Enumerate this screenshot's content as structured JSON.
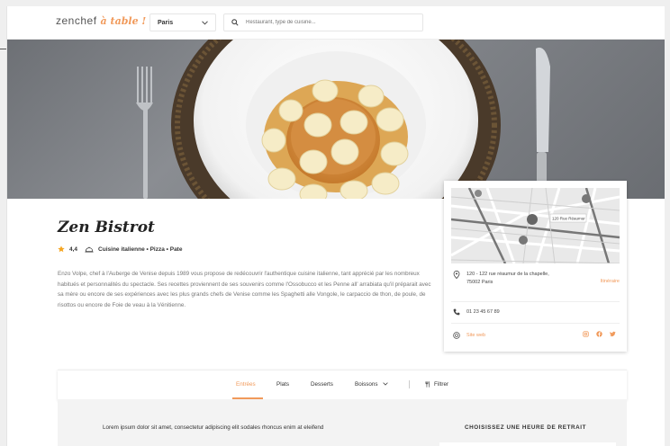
{
  "header": {
    "logo": "zenchef",
    "logo_tagline": "à table !",
    "city": "Paris",
    "search_placeholder": "Restaurant, type de cuisine..."
  },
  "restaurant": {
    "name": "Zen Bistrot",
    "rating": "4,4",
    "cuisines": "Cuisine italienne • Pizza • Pate",
    "description": "Enzo Volpe, chef à l'Auberge de Venise depuis 1989 vous propose de redécouvrir l'authentique cuisine italienne, tant apprécié par les nombreux habitués et personnalités du spectacle. Ses recettes proviennent de ses souvenirs comme l'Ossobucco et les Penne all' arrabiata qu'il préparait avec sa mère ou encore de ses expériences avec les plus grands chefs de Venise comme les Spaghetti alle Vongole, le carpaccio de thon, de poule, de risottos ou encore de Foie de veau à la Vénitienne."
  },
  "info_card": {
    "map_label": "120 Rue Réaumur",
    "address_line1": "120 - 122 rue réaumur de la chapelle,",
    "address_line2": "75002 Paris",
    "itinerary": "Itinéraire",
    "phone": "01 23 45 67 89",
    "website": "Site web"
  },
  "menu": {
    "tabs": [
      {
        "label": "Entrées",
        "active": true
      },
      {
        "label": "Plats",
        "active": false
      },
      {
        "label": "Desserts",
        "active": false
      },
      {
        "label": "Boissons",
        "active": false
      }
    ],
    "filter": "Filtrer"
  },
  "content": {
    "lorem": "Lorem ipsum dolor sit amet, consectetur adipiscing elit sodales rhoncus enim at eleifend",
    "pickup_title": "CHOISISSEZ UNE HEURE DE RETRAIT"
  },
  "colors": {
    "accent": "#f19a5b",
    "text": "#333333",
    "star": "#f5a623"
  }
}
